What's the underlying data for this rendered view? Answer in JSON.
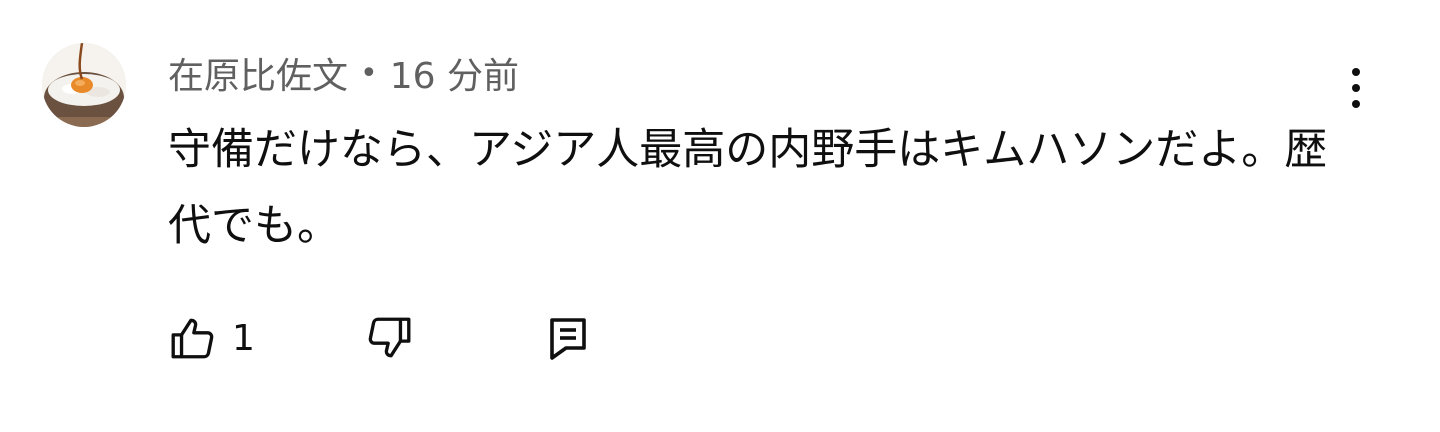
{
  "comment": {
    "author": "在原比佐文",
    "separator": "•",
    "time": "16 分前",
    "text": "守備だけなら、アジア人最高の内野手はキムハソンだよ。歴代でも。",
    "like_count": "1"
  },
  "icons": {
    "avatar": "avatar-rice-egg-icon",
    "menu": "more-vert-icon",
    "like": "thumb-up-icon",
    "dislike": "thumb-down-icon",
    "reply": "reply-comment-icon"
  },
  "colors": {
    "text": "#0f0f0f",
    "secondary_text": "#606060",
    "background": "#ffffff"
  }
}
